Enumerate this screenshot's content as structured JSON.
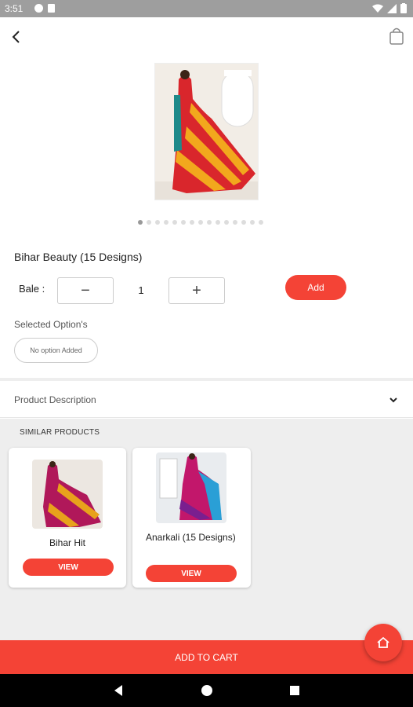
{
  "status_bar": {
    "time": "3:51"
  },
  "product": {
    "title": "Bihar Beauty (15 Designs)",
    "image_count": 15,
    "active_image_index": 0
  },
  "quantity": {
    "label": "Bale :",
    "value": "1",
    "minus_symbol": "−",
    "plus_symbol": "+",
    "add_label": "Add"
  },
  "options": {
    "label": "Selected Option's",
    "chip_text": "No option Added"
  },
  "description": {
    "label": "Product Description"
  },
  "similar": {
    "title": "SIMILAR PRODUCTS",
    "items": [
      {
        "name": "Bihar Hit",
        "button": "VIEW"
      },
      {
        "name": "Anarkali (15 Designs)",
        "button": "VIEW"
      }
    ]
  },
  "cart": {
    "label": "ADD TO CART"
  },
  "colors": {
    "accent": "#f44336",
    "status_bar": "#9e9e9e",
    "section_bg": "#eeeeee"
  },
  "icons": [
    "back-arrow-icon",
    "shopping-bag-icon",
    "chevron-down-icon",
    "home-icon"
  ]
}
